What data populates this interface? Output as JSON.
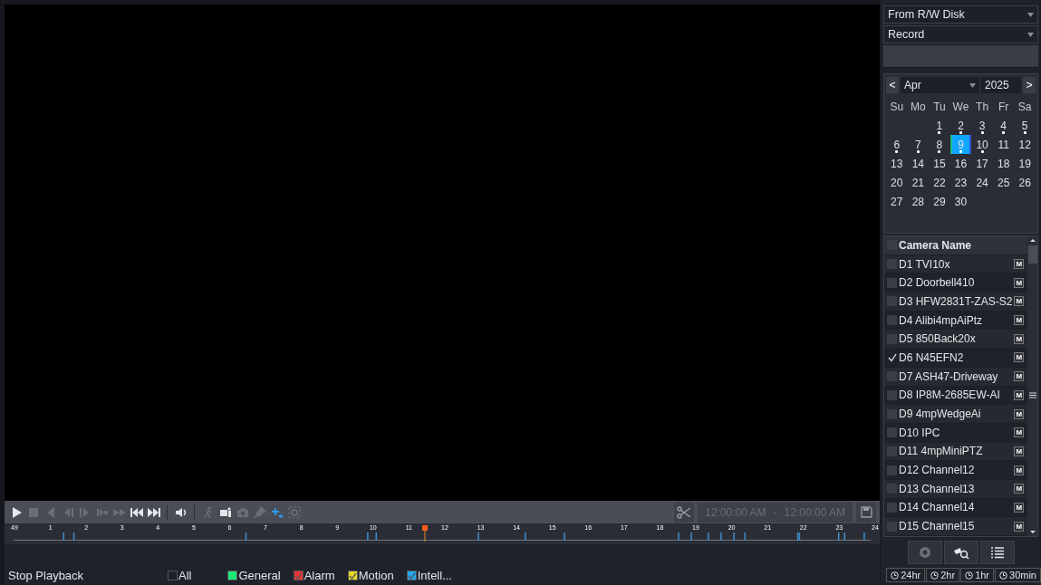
{
  "toolbar": {
    "tools": [
      {
        "kind": "play",
        "disabled": false
      },
      {
        "kind": "stop",
        "disabled": true
      },
      {
        "kind": "reverse",
        "disabled": true
      },
      {
        "kind": "step-back",
        "disabled": true
      },
      {
        "kind": "step-forward",
        "disabled": true
      },
      {
        "kind": "slow",
        "disabled": true
      },
      {
        "kind": "fast",
        "disabled": true
      },
      {
        "kind": "prev",
        "disabled": false
      },
      {
        "kind": "next",
        "disabled": false
      },
      {
        "kind": "sep",
        "disabled": false
      },
      {
        "kind": "volume",
        "disabled": false
      },
      {
        "kind": "sep",
        "disabled": false
      },
      {
        "kind": "person",
        "disabled": true
      },
      {
        "kind": "vehicle",
        "disabled": false
      },
      {
        "kind": "camera",
        "disabled": true
      },
      {
        "kind": "pin",
        "disabled": true
      },
      {
        "kind": "smart",
        "disabled": false
      },
      {
        "kind": "zoom",
        "disabled": true
      }
    ],
    "clip": {
      "start": "12:00:00 AM",
      "dash": "-",
      "end": "12:00:00 AM",
      "disabled": true
    }
  },
  "timeline": {
    "hours": [
      "49",
      "1",
      "2",
      "3",
      "4",
      "5",
      "6",
      "7",
      "8",
      "9",
      "10",
      "11",
      "12",
      "13",
      "14",
      "15",
      "16",
      "17",
      "18",
      "19",
      "20",
      "21",
      "22",
      "23",
      "24"
    ],
    "level": 0.48
  },
  "footer": {
    "action": "Stop Playback",
    "filters": [
      {
        "label": "All",
        "checked": false,
        "color": "#1e2029"
      },
      {
        "label": "General",
        "checked": false,
        "color": "#1ee878"
      },
      {
        "label": "Alarm",
        "checked": true,
        "color": "#ee3333"
      },
      {
        "label": "Motion",
        "checked": true,
        "color": "#e8d828"
      },
      {
        "label": "Intell...",
        "checked": true,
        "color": "#20a8f0"
      }
    ]
  },
  "sidebar": {
    "source": "From R/W Disk",
    "type": "Record",
    "calendar": {
      "prev": "<",
      "month": "Apr",
      "year": "2025",
      "next": ">",
      "weekdays": [
        "Su",
        "Mo",
        "Tu",
        "We",
        "Th",
        "Fr",
        "Sa"
      ],
      "weeks": [
        [
          {
            "day": "1",
            "recorded": true,
            "selected": false
          },
          {
            "day": "2",
            "recorded": true,
            "selected": false
          },
          {
            "day": "3",
            "recorded": true,
            "selected": false
          },
          {
            "day": "4",
            "recorded": true,
            "selected": false
          },
          {
            "day": "5",
            "recorded": true,
            "selected": false
          }
        ],
        [
          {
            "day": "6",
            "recorded": true,
            "selected": false
          },
          {
            "day": "7",
            "recorded": true,
            "selected": false
          },
          {
            "day": "8",
            "recorded": true,
            "selected": false
          },
          {
            "day": "9",
            "recorded": true,
            "selected": true
          },
          {
            "day": "10",
            "recorded": true,
            "selected": false
          },
          {
            "day": "11",
            "recorded": false,
            "selected": false
          },
          {
            "day": "12",
            "recorded": false,
            "selected": false
          }
        ],
        [
          {
            "day": "13",
            "recorded": false,
            "selected": false
          },
          {
            "day": "14",
            "recorded": false,
            "selected": false
          },
          {
            "day": "15",
            "recorded": false,
            "selected": false
          },
          {
            "day": "16",
            "recorded": false,
            "selected": false
          },
          {
            "day": "17",
            "recorded": false,
            "selected": false
          },
          {
            "day": "18",
            "recorded": false,
            "selected": false
          },
          {
            "day": "19",
            "recorded": false,
            "selected": false
          }
        ],
        [
          {
            "day": "20",
            "recorded": false,
            "selected": false
          },
          {
            "day": "21",
            "recorded": false,
            "selected": false
          },
          {
            "day": "22",
            "recorded": false,
            "selected": false
          },
          {
            "day": "23",
            "recorded": false,
            "selected": false
          },
          {
            "day": "24",
            "recorded": false,
            "selected": false
          },
          {
            "day": "25",
            "recorded": false,
            "selected": false
          },
          {
            "day": "26",
            "recorded": false,
            "selected": false
          }
        ],
        [
          {
            "day": "27",
            "recorded": false,
            "selected": false
          },
          {
            "day": "28",
            "recorded": false,
            "selected": false
          },
          {
            "day": "29",
            "recorded": false,
            "selected": false
          },
          {
            "day": "30",
            "recorded": false,
            "selected": false
          }
        ]
      ]
    },
    "cameras": {
      "header": "Camera Name",
      "all_checked": false,
      "items": [
        {
          "name": "D1 TVI10x",
          "checked": false,
          "mode": "M"
        },
        {
          "name": "D2 Doorbell410",
          "checked": false,
          "mode": "M"
        },
        {
          "name": "D3 HFW2831T-ZAS-S2",
          "checked": false,
          "mode": "M"
        },
        {
          "name": "D4 Alibi4mpAiPtz",
          "checked": false,
          "mode": "M"
        },
        {
          "name": "D5 850Back20x",
          "checked": false,
          "mode": "M"
        },
        {
          "name": "D6 N45EFN2",
          "checked": true,
          "mode": "M"
        },
        {
          "name": "D7 ASH47-Driveway",
          "checked": false,
          "mode": "M"
        },
        {
          "name": "D8 IP8M-2685EW-AI",
          "checked": false,
          "mode": "M"
        },
        {
          "name": "D9 4mpWedgeAi",
          "checked": false,
          "mode": "M"
        },
        {
          "name": "D10 IPC",
          "checked": false,
          "mode": "M"
        },
        {
          "name": "D11 4mpMiniPTZ",
          "checked": false,
          "mode": "M"
        },
        {
          "name": "D12 Channel12",
          "checked": false,
          "mode": "M"
        },
        {
          "name": "D13 Channel13",
          "checked": false,
          "mode": "M"
        },
        {
          "name": "D14 Channel14",
          "checked": false,
          "mode": "M"
        },
        {
          "name": "D15 Channel15",
          "checked": false,
          "mode": "M"
        }
      ]
    },
    "periods": [
      "24hr",
      "2hr",
      "1hr",
      "30min"
    ]
  }
}
